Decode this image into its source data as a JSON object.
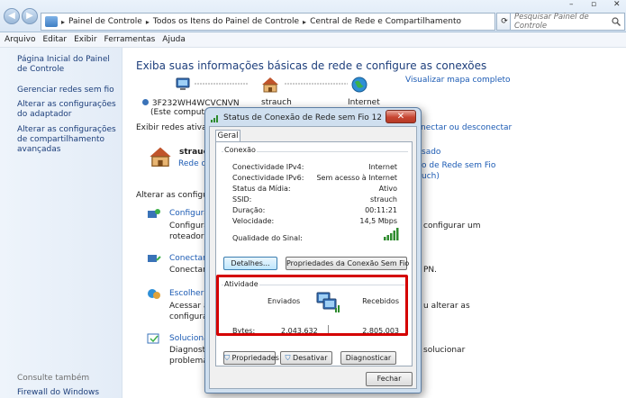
{
  "address_bar": {
    "crumbs": [
      "Painel de Controle",
      "Todos os Itens do Painel de Controle",
      "Central de Rede e Compartilhamento"
    ],
    "search_placeholder": "Pesquisar Painel de Controle"
  },
  "menu": [
    "Arquivo",
    "Editar",
    "Exibir",
    "Ferramentas",
    "Ajuda"
  ],
  "sidebar": {
    "links": [
      "Página Inicial do Painel de Controle",
      "Gerenciar redes sem fio",
      "Alterar as configurações do adaptador",
      "Alterar as configurações de compartilhamento avançadas"
    ],
    "see_also": "Consulte também",
    "see_also_links": [
      "Firewall do Windows"
    ]
  },
  "main": {
    "title": "Exiba suas informações básicas de rede e configure as conexões",
    "map_link": "Visualizar mapa completo",
    "nodes": [
      "3F232WH4WCVCNVN",
      "strauch",
      "Internet"
    ],
    "node_sub": "(Este computado",
    "active_networks": "Exibir redes ativas",
    "connect_link": "nectar ou desconectar",
    "network_name": "strauch",
    "network_type": "Rede do",
    "right_fragments": [
      "sado",
      "o de Rede sem Fio",
      "uch)"
    ],
    "change_section": "Alterar as configura",
    "tasks": [
      {
        "title": "Configura",
        "desc1": "Configurar",
        "desc2": "roteador ou",
        "right1": "configurar um",
        "right2": ""
      },
      {
        "title": "Conectar a",
        "desc1": "Conectar ou",
        "desc2": "",
        "right1": "PN.",
        "right2": ""
      },
      {
        "title": "Escolher op",
        "desc1": "Acessar ar",
        "desc2": "configuraçõ",
        "right1": "u alterar as",
        "right2": ""
      },
      {
        "title": "Solucionar",
        "desc1": "Diagnostic",
        "desc2": "problemas.",
        "right1": "solucionar",
        "right2": ""
      }
    ]
  },
  "dialog": {
    "title": "Status de Conexão de Rede sem Fio 12",
    "close": "✕",
    "tab": "Geral",
    "connection_group": "Conexão",
    "rows": [
      {
        "label": "Conectividade IPv4:",
        "value": "Internet"
      },
      {
        "label": "Conectividade IPv6:",
        "value": "Sem acesso à Internet"
      },
      {
        "label": "Status da Mídia:",
        "value": "Ativo"
      },
      {
        "label": "SSID:",
        "value": "strauch"
      },
      {
        "label": "Duração:",
        "value": "00:11:21"
      },
      {
        "label": "Velocidade:",
        "value": "14,5 Mbps"
      }
    ],
    "signal_label": "Qualidade do Sinal:",
    "details_button": "Detalhes...",
    "wifi_props_button": "Propriedades da Conexão Sem Fio",
    "activity_group": "Atividade",
    "sent_label": "Enviados",
    "received_label": "Recebidos",
    "bytes_label": "Bytes:",
    "bytes_sent": "2.043.632",
    "bytes_received": "2.805.003",
    "properties_button": "Propriedades",
    "disable_button": "Desativar",
    "diagnose_button": "Diagnosticar",
    "close_button": "Fechar"
  },
  "colors": {
    "link": "#1c5bb4",
    "highlight": "#d40000",
    "signal": "#2e8b2e"
  }
}
